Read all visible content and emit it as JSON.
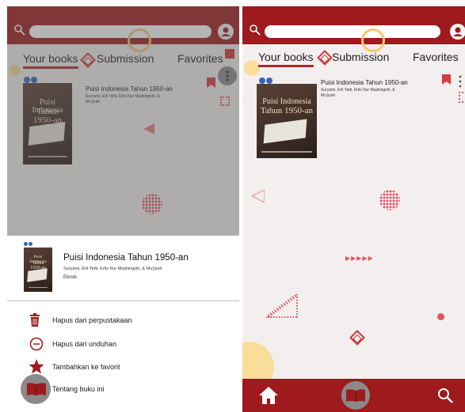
{
  "tabs": {
    "your_books": "Your books",
    "submission": "Submission",
    "favorites": "Favorites"
  },
  "book": {
    "title": "Puisi Indonesia Tahun 1950-an",
    "authors": "Suryami, Erli Yetti, Erlis Nur Mujiningsih, & Mu'jizah",
    "cover_title_line1": "Puisi Indonesia",
    "cover_title_line2": "Tahun 1950-an",
    "format": "Ebook"
  },
  "menu": [
    {
      "label": "Hapus dari perpustakaan",
      "icon": "trash-icon"
    },
    {
      "label": "Hapus dari unduhan",
      "icon": "remove-circle-icon"
    },
    {
      "label": "Tambahkan ke favorit",
      "icon": "star-icon"
    },
    {
      "label": "Tentang buku ini",
      "icon": "open-book-icon"
    }
  ],
  "colors": {
    "primary": "#9e1a1d",
    "accent": "#d93b45",
    "background": "#f4efef"
  }
}
